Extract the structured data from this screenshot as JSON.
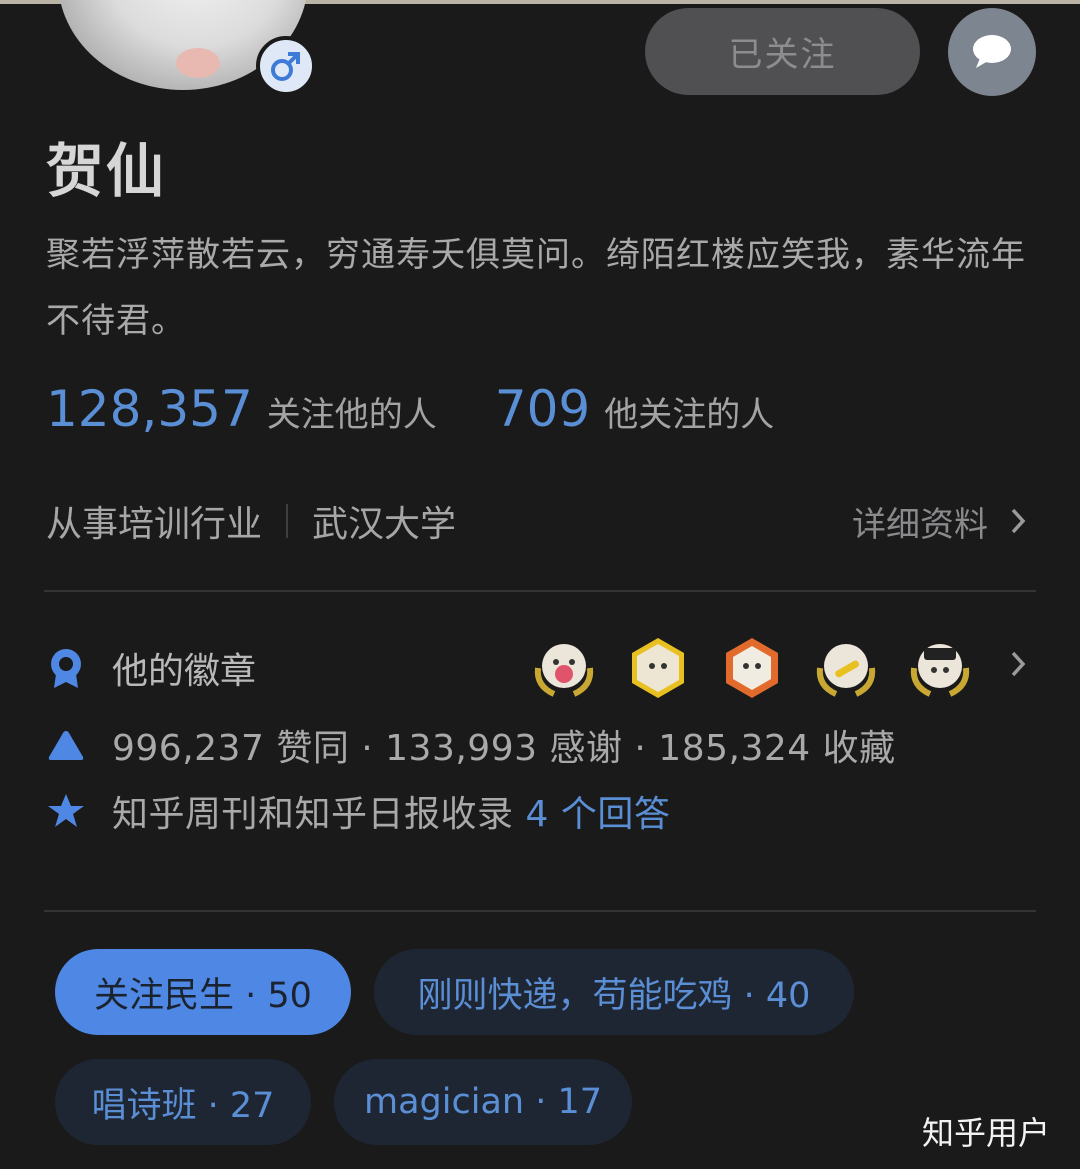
{
  "profile": {
    "name": "贺仙",
    "bio": "聚若浮萍散若云，穷通寿夭俱莫问。绮陌红楼应笑我，素华流年不待君。",
    "follow_label": "已关注"
  },
  "stats": [
    {
      "value": "128,357",
      "label": "关注他的人"
    },
    {
      "value": "709",
      "label": "他关注的人"
    }
  ],
  "info": {
    "industry": "从事培训行业",
    "school": "武汉大学",
    "detail_label": "详细资料"
  },
  "badges": {
    "label": "他的徽章",
    "medal_count_shown": 5
  },
  "achievements": {
    "votes_line": "996,237 赞同 · 133,993 感谢 · 185,324 收藏",
    "featured_prefix": "知乎周刊和知乎日报收录",
    "featured_count": "4 个回答"
  },
  "tags": [
    {
      "label": "关注民生 · 50",
      "active": true
    },
    {
      "label": "刚则快递，苟能吃鸡 · 40",
      "active": false
    },
    {
      "label": "唱诗班 · 27",
      "active": false
    },
    {
      "label": "magician · 17",
      "active": false
    }
  ],
  "watermark": "知乎用户",
  "colors": {
    "background": "#1a1a1b",
    "accent": "#5a8fd6",
    "active_tag": "#4e88e4"
  }
}
